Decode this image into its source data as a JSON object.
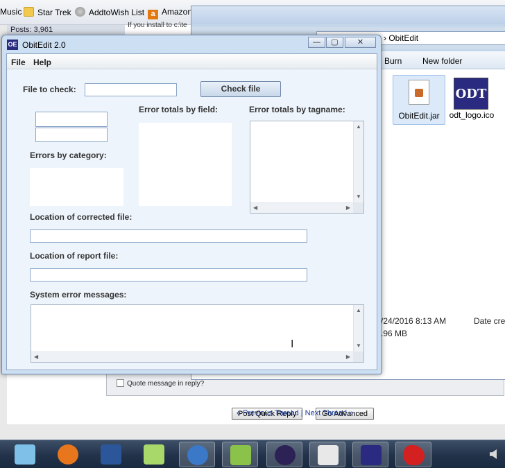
{
  "browser": {
    "bookmarks": [
      {
        "label": "Music",
        "icon": "music-bookmark"
      },
      {
        "label": "Star Trek",
        "icon": "folder-icon"
      },
      {
        "label": "AddtoWish List",
        "icon": "globe-icon"
      },
      {
        "label": "Amazon",
        "icon": "amazon-icon"
      }
    ],
    "forum": {
      "posts": "Posts: 3,961",
      "snippet": "If you install to c:\\te",
      "quote_label": "Quote message in reply?",
      "post_quick_reply": "Post Quick Reply",
      "go_advanced": "Go Advanced",
      "previous_thread": "« Previous Thread",
      "separator": "|",
      "next_thread": "Next Thread »"
    }
  },
  "explorer": {
    "address_tail": "gram Files (x86)  ›  ObitEdit",
    "toolbar": [
      "Burn",
      "New folder"
    ],
    "files": [
      {
        "name": "ObitEdit.jar",
        "icon": "jar-file-icon"
      },
      {
        "name": "odt_logo.ico",
        "icon": "odt-logo-icon"
      }
    ],
    "date_modified": "/24/2016 8:13 AM",
    "date_created_label": "Date crea",
    "size": ".96 MB"
  },
  "obitedit": {
    "title": "ObitEdit 2.0",
    "app_icon_text": "OE",
    "window_buttons": {
      "minimize": "—",
      "maximize": "▢",
      "close": "✕"
    },
    "menu": {
      "file": "File",
      "help": "Help"
    },
    "file_to_check_label": "File to check:",
    "file_to_check_value": "",
    "check_file_button": "Check file",
    "error_totals_by_field_label": "Error totals by field:",
    "error_totals_by_tagname_label": "Error totals by tagname:",
    "errors_by_category_label": "Errors by category:",
    "location_corrected_label": "Location of corrected file:",
    "location_corrected_value": "",
    "location_report_label": "Location of report file:",
    "location_report_value": "",
    "system_error_label": "System error messages:"
  },
  "taskbar": {
    "items": [
      {
        "name": "notepad-app",
        "color": "#7ec0e8"
      },
      {
        "name": "firefox-app",
        "color": "#e8761c"
      },
      {
        "name": "word-app",
        "color": "#2b579a"
      },
      {
        "name": "sticky-notes-app",
        "color": "#a8d86a"
      },
      {
        "name": "thunderbird-app",
        "color": "#3b78c8"
      },
      {
        "name": "notepadpp-app",
        "color": "#8bc34a"
      },
      {
        "name": "eclipse-app",
        "color": "#2c2255"
      },
      {
        "name": "java-app",
        "color": "#e8e8e8"
      },
      {
        "name": "obitedit-app",
        "color": "#2a2a80"
      },
      {
        "name": "splat-app",
        "color": "#d32020"
      }
    ]
  },
  "colors": {
    "window_frame": "#cde0f3",
    "client_bg": "#eef4fb",
    "field_border": "#8aa6c8",
    "taskbar": "#22324a"
  }
}
